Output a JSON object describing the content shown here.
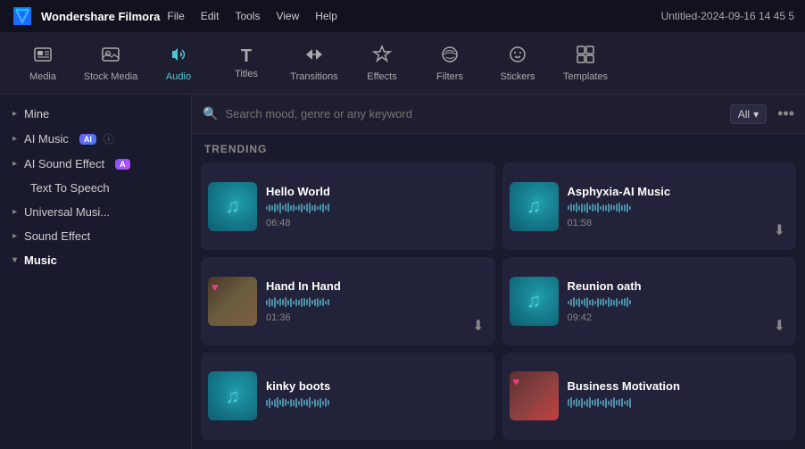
{
  "app": {
    "logo_text": "W",
    "name": "Wondershare Filmora",
    "menu": [
      "File",
      "Edit",
      "Tools",
      "View",
      "Help"
    ],
    "title": "Untitled-2024-09-16 14 45 5"
  },
  "toolbar": {
    "items": [
      {
        "id": "media",
        "label": "Media",
        "icon": "⬜"
      },
      {
        "id": "stock-media",
        "label": "Stock Media",
        "icon": "🎞"
      },
      {
        "id": "audio",
        "label": "Audio",
        "icon": "♪",
        "active": true
      },
      {
        "id": "titles",
        "label": "Titles",
        "icon": "T"
      },
      {
        "id": "transitions",
        "label": "Transitions",
        "icon": "↔"
      },
      {
        "id": "effects",
        "label": "Effects",
        "icon": "✦"
      },
      {
        "id": "filters",
        "label": "Filters",
        "icon": "⬡"
      },
      {
        "id": "stickers",
        "label": "Stickers",
        "icon": "❋"
      },
      {
        "id": "templates",
        "label": "Templates",
        "icon": "⊞"
      }
    ]
  },
  "sidebar": {
    "items": [
      {
        "id": "mine",
        "label": "Mine",
        "type": "section",
        "expanded": false
      },
      {
        "id": "ai-music",
        "label": "AI Music",
        "type": "section",
        "expanded": false,
        "badge": "AI",
        "has_info": true
      },
      {
        "id": "ai-sound-effect",
        "label": "AI Sound Effect",
        "type": "section",
        "expanded": false,
        "badge": "A"
      },
      {
        "id": "text-to-speech",
        "label": "Text To Speech",
        "type": "plain"
      },
      {
        "id": "universal-music",
        "label": "Universal Musi...",
        "type": "section",
        "expanded": false
      },
      {
        "id": "sound-effect",
        "label": "Sound Effect",
        "type": "section",
        "expanded": false
      },
      {
        "id": "music",
        "label": "Music",
        "type": "section",
        "expanded": true,
        "active": true
      }
    ]
  },
  "search": {
    "placeholder": "Search mood, genre or any keyword",
    "filter_label": "All"
  },
  "trending": {
    "label": "TRENDING"
  },
  "cards": [
    {
      "id": "hello-world",
      "title": "Hello World",
      "duration": "06:48",
      "thumb_type": "teal",
      "has_download": false,
      "has_heart": false
    },
    {
      "id": "asphyxia",
      "title": "Asphyxia-AI Music",
      "duration": "01:58",
      "thumb_type": "teal",
      "has_download": true,
      "has_heart": false
    },
    {
      "id": "hand-in-hand",
      "title": "Hand In Hand",
      "duration": "01:36",
      "thumb_type": "nature",
      "has_download": true,
      "has_heart": true
    },
    {
      "id": "reunion-oath",
      "title": "Reunion oath",
      "duration": "09:42",
      "thumb_type": "teal",
      "has_download": true,
      "has_heart": false
    },
    {
      "id": "kinky-boots",
      "title": "kinky boots",
      "duration": "",
      "thumb_type": "teal",
      "has_download": false,
      "has_heart": false
    },
    {
      "id": "business-motivation",
      "title": "Business Motivation",
      "duration": "",
      "thumb_type": "biz",
      "has_download": false,
      "has_heart": true
    }
  ],
  "icons": {
    "search": "🔍",
    "chevron_down": "▾",
    "chevron_right": "▸",
    "more": "•••",
    "download": "⬇",
    "heart": "♥",
    "music_note": "♫"
  }
}
